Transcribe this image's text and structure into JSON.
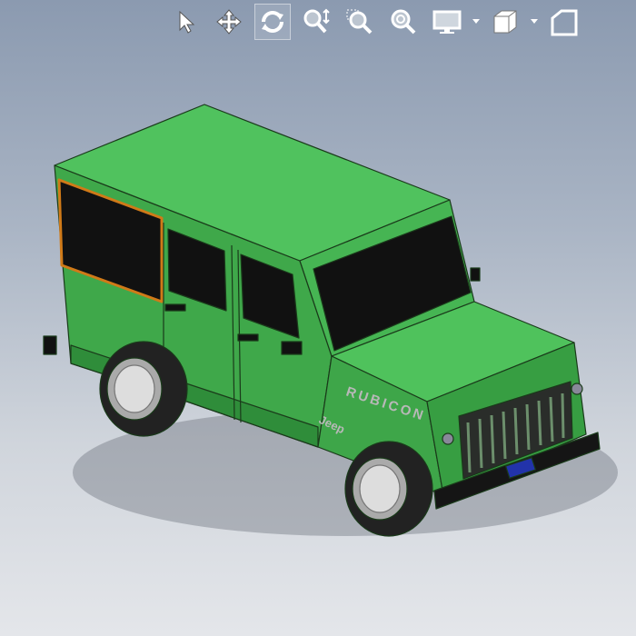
{
  "toolbar": {
    "tools": [
      {
        "icon": "select-arrow-icon",
        "active": false
      },
      {
        "icon": "pan-icon",
        "active": false
      },
      {
        "icon": "rotate-view-icon",
        "active": true
      },
      {
        "icon": "zoom-in-out-icon",
        "active": false
      },
      {
        "icon": "zoom-to-area-icon",
        "active": false
      },
      {
        "icon": "zoom-to-fit-icon",
        "active": false
      },
      {
        "icon": "display-style-icon",
        "active": false
      },
      {
        "icon": "view-orientation-icon",
        "active": false
      }
    ]
  },
  "model": {
    "body_color": "#4cc05a",
    "decal_text": "RUBICON",
    "brand_text": "Jeep"
  }
}
